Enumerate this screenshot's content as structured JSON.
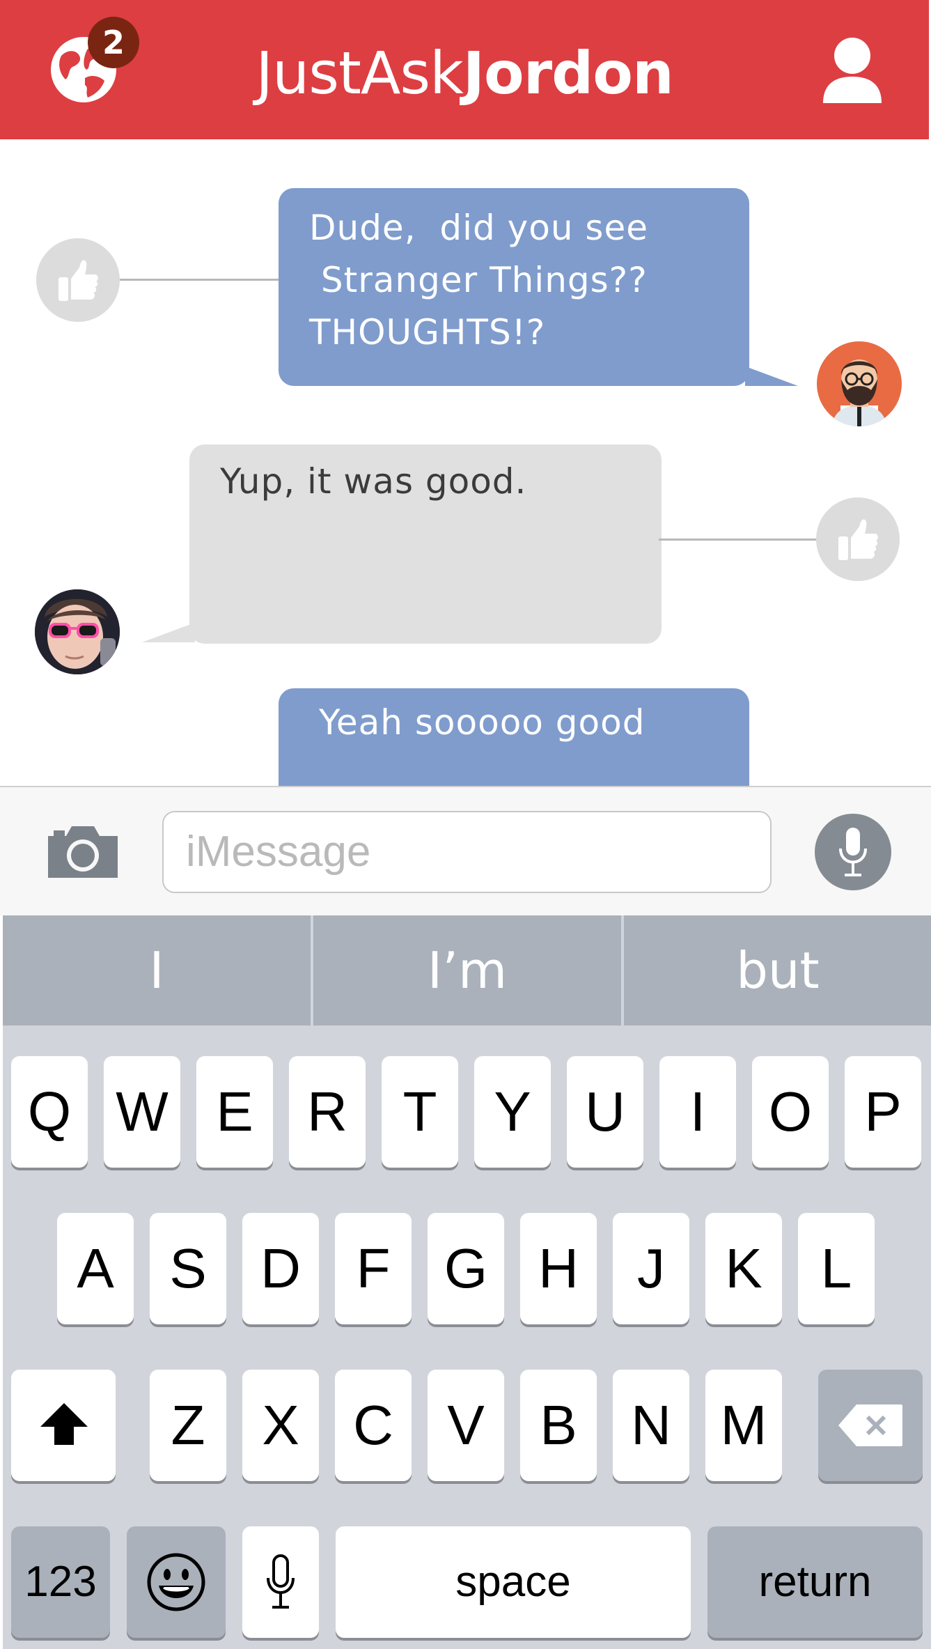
{
  "colors": {
    "header": "#dd3e42",
    "badge": "#7a2512",
    "bubble_sent": "#7f9ccd",
    "bubble_received": "#e0e0e0",
    "keyboard": "#d1d5db",
    "suggestion_bar": "#aab1bb"
  },
  "header": {
    "title_part1": "Just",
    "title_part2": "Ask",
    "title_part3": "Jordon",
    "notification_count": "2",
    "left_icon": "globe-icon",
    "right_icon": "user-icon"
  },
  "messages": [
    {
      "side": "sent",
      "lines": [
        "Dude,  did you see",
        " Stranger Things??",
        "THOUGHTS!?"
      ],
      "avatar": "bearded-man-avatar",
      "like_icon": "thumbs-up-icon"
    },
    {
      "side": "received",
      "lines": [
        "Yup, it was good."
      ],
      "avatar": "sunglasses-user-avatar",
      "like_icon": "thumbs-up-icon"
    },
    {
      "side": "sent",
      "lines": [
        "Yeah sooooo good"
      ]
    }
  ],
  "input": {
    "placeholder": "iMessage",
    "camera_icon": "camera-icon",
    "mic_icon": "microphone-icon"
  },
  "suggestions": [
    "I",
    "I’m",
    "but"
  ],
  "keyboard": {
    "row1": [
      "Q",
      "W",
      "E",
      "R",
      "T",
      "Y",
      "U",
      "I",
      "O",
      "P"
    ],
    "row2": [
      "A",
      "S",
      "D",
      "F",
      "G",
      "H",
      "J",
      "K",
      "L"
    ],
    "row3": [
      "Z",
      "X",
      "C",
      "V",
      "B",
      "N",
      "M"
    ],
    "shift_icon": "shift-arrow-icon",
    "delete_icon": "backspace-icon",
    "numbers_label": "123",
    "emoji_icon": "emoji-icon",
    "dictation_icon": "microphone-icon",
    "space_label": "space",
    "return_label": "return"
  }
}
